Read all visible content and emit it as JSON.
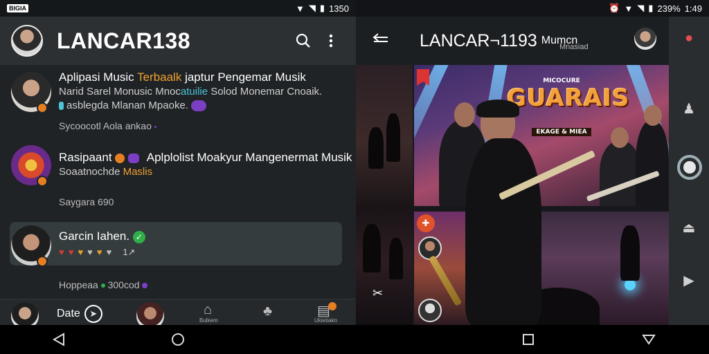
{
  "left": {
    "status": {
      "carrier": "BIGIA",
      "time": "1350"
    },
    "appbar": {
      "title": "LANCAR138",
      "search_icon": "search-icon",
      "menu_icon": "more-vert-icon"
    },
    "items": [
      {
        "title_pre": "Aplipasi Music ",
        "title_hl": "Terbaalk",
        "title_post": " japtur Pengemar Musik",
        "sub1_pre": "Narid Sarel Monusic Mnoc",
        "sub1_hl": "atuilie",
        "sub1_post": " Solod Monemar Cnoaik.",
        "sub2": "asblegda Mlanan Mpaoke.",
        "meta": "Sycoocotl Aola ankao"
      },
      {
        "title": "Rasipaant",
        "title_post": "Aplplolist Moakyur Mangenermat Musik",
        "sub_pre": "Soaatnochde ",
        "sub_hl": "Maslis",
        "meta": "Saygara 690"
      },
      {
        "title": "Garcin Iahen.",
        "meta_num": "1↗",
        "footer_pre": "Hoppeaa",
        "footer_post": "300cod"
      }
    ],
    "bottomnav": {
      "label": "Date",
      "small1": "Bulkem",
      "small2": "Ukietiakn"
    }
  },
  "right": {
    "status": {
      "battery": "239%",
      "time": "1:49"
    },
    "appbar": {
      "title": "LANCAR¬1193",
      "title_tail": "Mumcn",
      "subtitle": "Mnasiad"
    },
    "hero": {
      "logo_top": "MICOCURE",
      "logo_main": "GUARAIS",
      "logo_bottom": "EKAGE & MIEA"
    }
  },
  "colors": {
    "accent_orange": "#e67e22",
    "accent_green": "#2fae4a",
    "accent_purple": "#7b3fc4",
    "accent_teal": "#4fc3d7"
  }
}
